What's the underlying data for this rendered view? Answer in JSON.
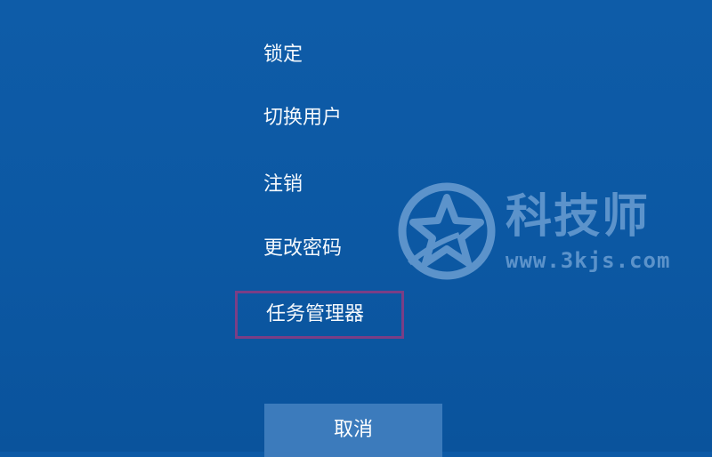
{
  "menu": {
    "items": [
      {
        "label": "锁定"
      },
      {
        "label": "切换用户"
      },
      {
        "label": "注销"
      },
      {
        "label": "更改密码"
      },
      {
        "label": "任务管理器",
        "selected": true
      }
    ]
  },
  "cancel_label": "取消",
  "watermark": {
    "title": "科技师",
    "url": "www.3kjs.com"
  },
  "colors": {
    "background": "#0c58a3",
    "button": "#3c7bbc",
    "selection_border": "#7a3e86",
    "text": "#ffffff"
  }
}
